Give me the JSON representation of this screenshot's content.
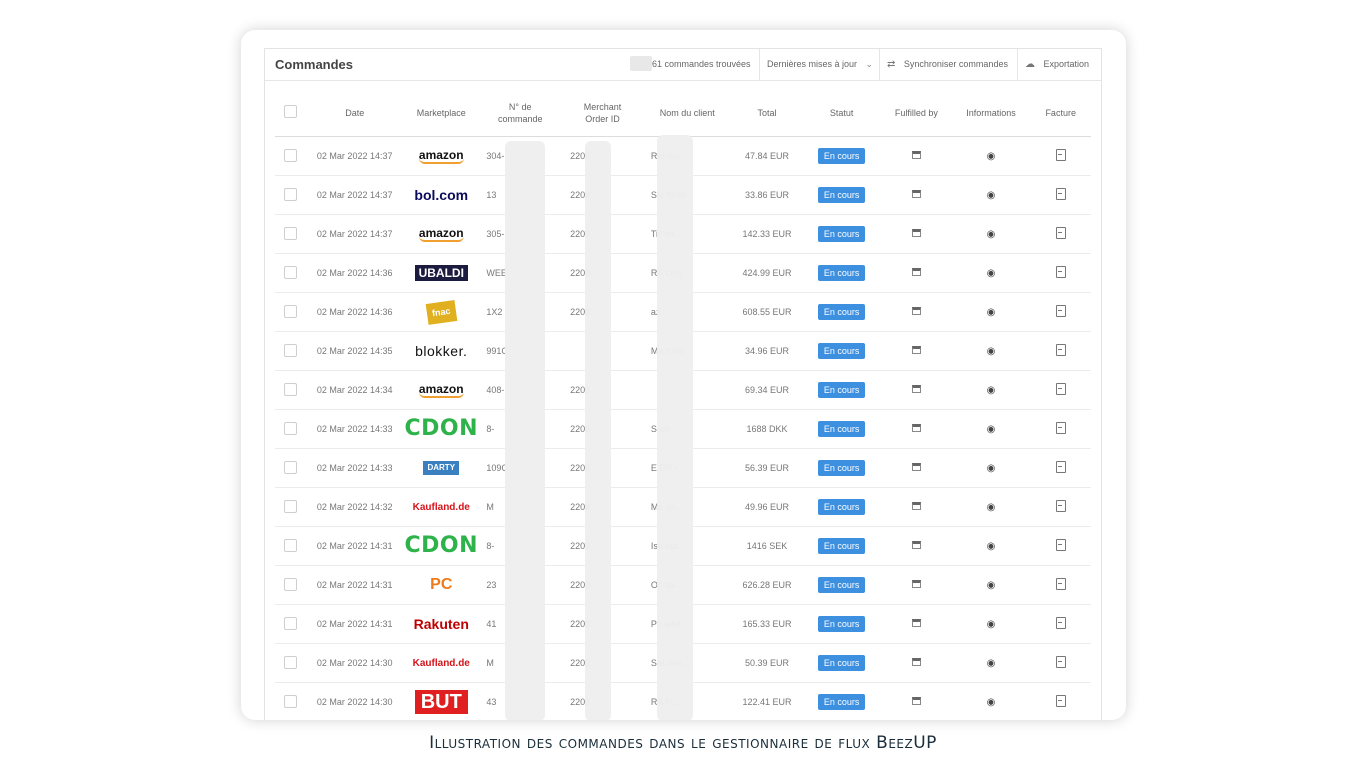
{
  "header": {
    "title": "Commandes",
    "count": "61 commandes trouvées",
    "sort_label": "Dernières mises à jour",
    "sync_label": "Synchroniser commandes",
    "export_label": "Exportation"
  },
  "columns": {
    "date": "Date",
    "marketplace": "Marketplace",
    "order_no_1": "N° de",
    "order_no_2": "commande",
    "merchant_1": "Merchant",
    "merchant_2": "Order ID",
    "client": "Nom du client",
    "total": "Total",
    "status": "Statut",
    "fulfilled": "Fulfilled by",
    "info": "Informations",
    "invoice": "Facture"
  },
  "rows": [
    {
      "date": "02 Mar 2022 14:37",
      "marketplace": "amazon",
      "order_no": "304-",
      "merchant_id": "2203",
      "client": "Rel        rpa...",
      "total": "47.84 EUR",
      "status": "En cours"
    },
    {
      "date": "02 Mar 2022 14:37",
      "marketplace": "bol.com",
      "order_no": "13",
      "merchant_id": "2203",
      "client": "Ste        Noel",
      "total": "33.86 EUR",
      "status": "En cours"
    },
    {
      "date": "02 Mar 2022 14:37",
      "marketplace": "amazon",
      "order_no": "305-",
      "merchant_id": "2203",
      "client": "Tit        'olf...",
      "total": "142.33 EUR",
      "status": "En cours"
    },
    {
      "date": "02 Mar 2022 14:36",
      "marketplace": "UBALDI",
      "order_no": "WEE",
      "merchant_id": "2203",
      "client": "RA        ONI",
      "total": "424.99 EUR",
      "status": "En cours"
    },
    {
      "date": "02 Mar 2022 14:36",
      "marketplace": "fnac",
      "order_no": "1X2",
      "merchant_id": "2203",
      "client": "          az",
      "total": "608.55 EUR",
      "status": "En cours"
    },
    {
      "date": "02 Mar 2022 14:35",
      "marketplace": "blokker.",
      "order_no": "991C",
      "merchant_id": "",
      "client": "Ma        rnds",
      "total": "34.96 EUR",
      "status": "En cours"
    },
    {
      "date": "02 Mar 2022 14:34",
      "marketplace": "amazon",
      "order_no": "408-",
      "merchant_id": "2203",
      "client": "",
      "total": "69.34 EUR",
      "status": "En cours"
    },
    {
      "date": "02 Mar 2022 14:33",
      "marketplace": "CDON",
      "order_no": "8-",
      "merchant_id": "2203",
      "client": "S        en",
      "total": "1688 DKK",
      "status": "En cours"
    },
    {
      "date": "02 Mar 2022 14:33",
      "marketplace": "DARTY",
      "order_no": "109C",
      "merchant_id": "2203",
      "client": "E        DRY",
      "total": "56.39 EUR",
      "status": "En cours"
    },
    {
      "date": "02 Mar 2022 14:32",
      "marketplace": "Kaufland.de",
      "order_no": "M",
      "merchant_id": "2203",
      "client": "Me        en...",
      "total": "49.96 EUR",
      "status": "En cours"
    },
    {
      "date": "02 Mar 2022 14:31",
      "marketplace": "CDON",
      "order_no": "8-",
      "merchant_id": "2203",
      "client": "Isa        taz...",
      "total": "1416 SEK",
      "status": "En cours"
    },
    {
      "date": "02 Mar 2022 14:31",
      "marketplace": "PC",
      "order_no": "23",
      "merchant_id": "2203",
      "client": "On        as ...",
      "total": "626.28 EUR",
      "status": "En cours"
    },
    {
      "date": "02 Mar 2022 14:31",
      "marketplace": "Rakuten",
      "order_no": "41",
      "merchant_id": "2203",
      "client": "Ph        allet",
      "total": "165.33 EUR",
      "status": "En cours"
    },
    {
      "date": "02 Mar 2022 14:30",
      "marketplace": "Kaufland.de",
      "order_no": "M",
      "merchant_id": "2203",
      "client": "Sat        den...",
      "total": "50.39 EUR",
      "status": "En cours"
    },
    {
      "date": "02 Mar 2022 14:30",
      "marketplace": "BUT",
      "order_no": "43",
      "merchant_id": "2203",
      "client": "RA        N...",
      "total": "122.41 EUR",
      "status": "En cours"
    }
  ],
  "caption": "Illustration des commandes dans le gestionnaire de flux BeezUP",
  "colors": {
    "status_badge": "#3d8fe0",
    "caption": "#1a2e3b"
  }
}
